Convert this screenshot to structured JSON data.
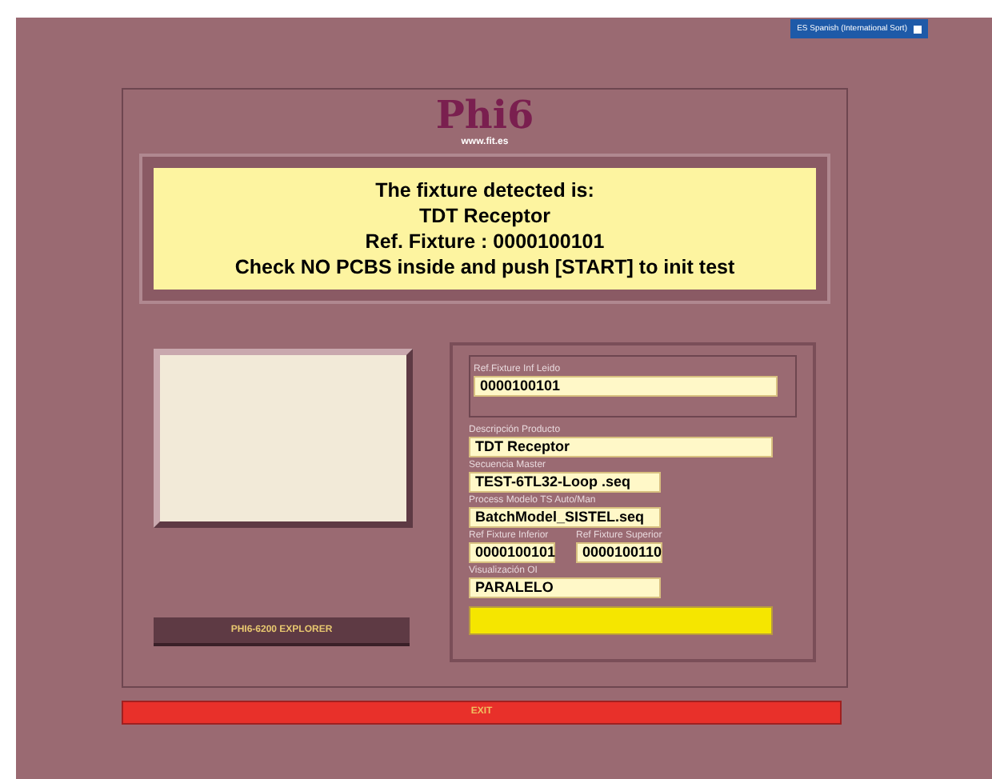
{
  "language_selector": {
    "label": "ES Spanish (International Sort)"
  },
  "logo": {
    "title": "Phi6",
    "url": "www.fit.es"
  },
  "message": {
    "lines": [
      "The fixture detected is:",
      "TDT Receptor",
      "Ref. Fixture : 0000100101",
      "Check NO PCBS inside and push [START] to init test"
    ]
  },
  "explorer_button": {
    "label": "PHI6-6200 EXPLORER"
  },
  "read_fixture": {
    "label": "Ref.Fixture Inf Leido",
    "value": "0000100101"
  },
  "fields": [
    {
      "label": "Descripción Producto",
      "value": "TDT Receptor",
      "kind": "wide"
    },
    {
      "label": "Secuencia Master",
      "value": "TEST-6TL32-Loop .seq",
      "kind": "medium"
    },
    {
      "label": "Process Modelo TS Auto/Man",
      "value": "BatchModel_SISTEL.seq",
      "kind": "medium"
    }
  ],
  "fixture_range": [
    {
      "label": "Ref Fixture Inferior",
      "value": "0000100101"
    },
    {
      "label": "Ref Fixture Superior",
      "value": "0000100110"
    }
  ],
  "visualization": {
    "label": "Visualización OI",
    "value": "PARALELO"
  },
  "status_indicator": {
    "color": "#f5e600"
  },
  "exit_button": {
    "label": "EXIT"
  }
}
